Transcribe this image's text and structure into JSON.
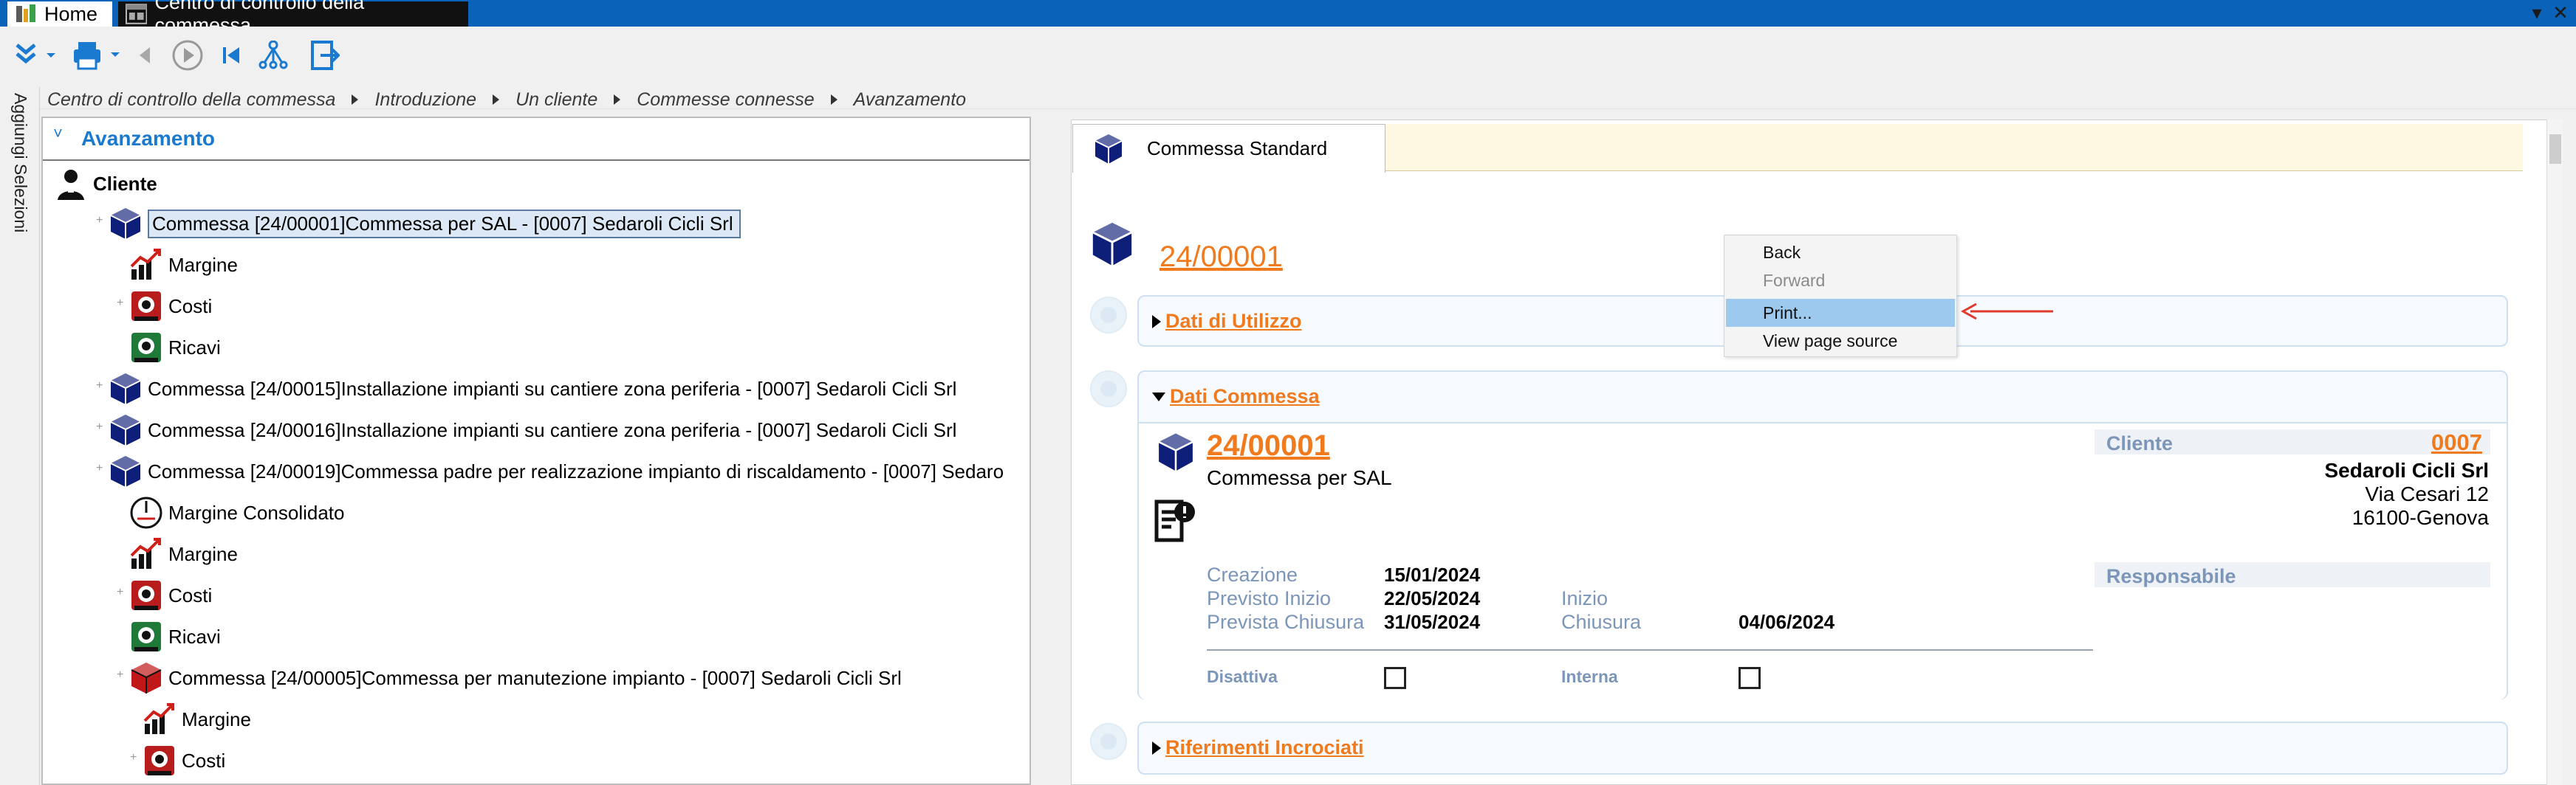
{
  "window": {
    "tabs": [
      {
        "label": "Home"
      },
      {
        "label": "Centro di controllo della commessa"
      }
    ]
  },
  "breadcrumb": [
    "Centro di controllo della commessa",
    "Introduzione",
    "Un cliente",
    "Commesse connesse",
    "Avanzamento"
  ],
  "side_strip": {
    "label": "Aggiungi Selezioni"
  },
  "tree": {
    "title": "Avanzamento",
    "root": "Cliente",
    "rows": [
      {
        "label": "Commessa [24/00001]Commessa per SAL - [0007] Sedaroli Cicli Srl",
        "icon": "cube-icon"
      },
      {
        "label": "Margine",
        "icon": "margin-chart-icon"
      },
      {
        "label": "Costi",
        "icon": "costs-register-icon"
      },
      {
        "label": "Ricavi",
        "icon": "revenue-register-icon"
      },
      {
        "label": "Commessa [24/00015]Installazione impianti su cantiere zona periferia - [0007] Sedaroli Cicli Srl",
        "icon": "cube-icon"
      },
      {
        "label": "Commessa [24/00016]Installazione impianti su cantiere zona periferia - [0007] Sedaroli Cicli Srl",
        "icon": "cube-icon"
      },
      {
        "label": "Commessa [24/00019]Commessa padre per realizzazione impianto di riscaldamento - [0007] Sedaro",
        "icon": "cube-icon"
      },
      {
        "label": "Margine Consolidato",
        "icon": "gauge-icon"
      },
      {
        "label": "Margine",
        "icon": "margin-chart-icon"
      },
      {
        "label": "Costi",
        "icon": "costs-register-icon"
      },
      {
        "label": "Ricavi",
        "icon": "revenue-register-icon"
      },
      {
        "label": "Commessa [24/00005]Commessa per manutezione impianto - [0007] Sedaroli Cicli Srl",
        "icon": "cube-red-icon"
      },
      {
        "label": "Margine",
        "icon": "margin-chart-icon"
      },
      {
        "label": "Costi",
        "icon": "costs-register-icon"
      }
    ]
  },
  "content": {
    "tab_label": "Commessa Standard",
    "header_code": "24/00001",
    "sections": {
      "utilizzo": "Dati di Utilizzo",
      "commessa": "Dati Commessa",
      "riferimenti": "Riferimenti Incrociati"
    },
    "detail": {
      "code": "24/00001",
      "description": "Commessa per SAL",
      "cliente_label": "Cliente",
      "cliente_code": "0007",
      "cliente_name": "Sedaroli Cicli Srl",
      "cliente_address": "Via Cesari 12",
      "cliente_city": "16100-Genova",
      "responsabile_label": "Responsabile",
      "creazione_label": "Creazione",
      "creazione_value": "15/01/2024",
      "previsto_inizio_label": "Previsto Inizio",
      "previsto_inizio_value": "22/05/2024",
      "prevista_chiusura_label": "Prevista Chiusura",
      "prevista_chiusura_value": "31/05/2024",
      "inizio_label": "Inizio",
      "chiusura_label": "Chiusura",
      "chiusura_value": "04/06/2024",
      "disattiva_label": "Disattiva",
      "interna_label": "Interna"
    }
  },
  "context_menu": {
    "items": [
      "Back",
      "Forward",
      "Print...",
      "View page source"
    ]
  },
  "colors": {
    "titlebar": "#0a63b8",
    "accent_blue": "#1a7ad0",
    "link_orange": "#f07a1e",
    "annotation_red": "#e03a2f",
    "menu_hover": "#9ec9ef"
  }
}
